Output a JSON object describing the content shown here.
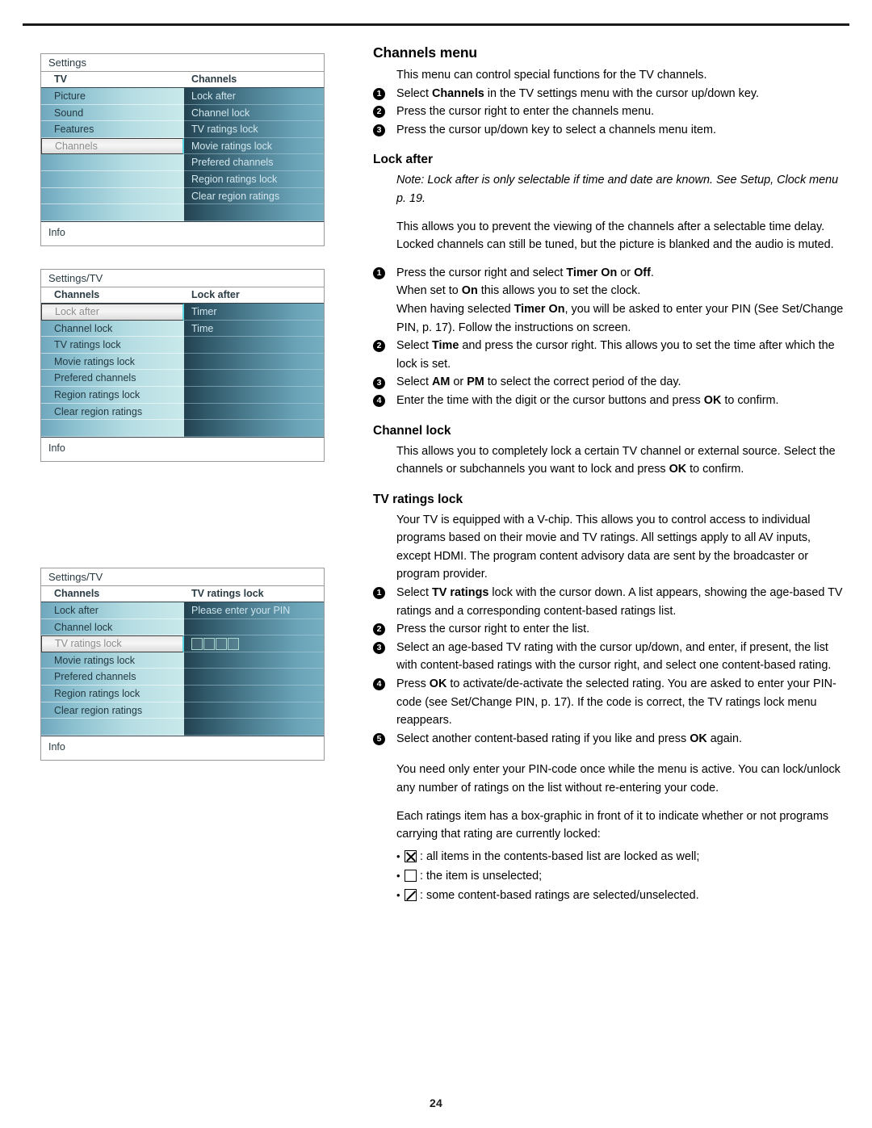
{
  "page": {
    "number": "24"
  },
  "osd_panels": [
    {
      "id": "settings-channels",
      "title": "Settings",
      "left_header": "TV",
      "right_header": "Channels",
      "left_items": [
        "Picture",
        "Sound",
        "Features",
        "Channels",
        "",
        "",
        "",
        ""
      ],
      "left_selected_index": 3,
      "right_items": [
        "Lock after",
        "Channel lock",
        "TV ratings lock",
        "Movie ratings lock",
        "Prefered channels",
        "Region ratings lock",
        "Clear region ratings",
        ""
      ],
      "info_label": "Info",
      "pin_prompt": "",
      "pin_boxes": 0
    },
    {
      "id": "settings-tv-lock-after",
      "title": "Settings/TV",
      "left_header": "Channels",
      "right_header": "Lock after",
      "left_items": [
        "Lock after",
        "Channel lock",
        "TV ratings lock",
        "Movie ratings lock",
        "Prefered channels",
        "Region ratings lock",
        "Clear region ratings",
        ""
      ],
      "left_selected_index": 0,
      "right_items": [
        "Timer",
        "Time",
        "",
        "",
        "",
        "",
        "",
        ""
      ],
      "info_label": "Info",
      "pin_prompt": "",
      "pin_boxes": 0
    },
    {
      "id": "settings-tv-ratings-lock",
      "title": "Settings/TV",
      "left_header": "Channels",
      "right_header": "TV ratings lock",
      "left_items": [
        "Lock after",
        "Channel lock",
        "TV ratings lock",
        "Movie ratings lock",
        "Prefered channels",
        "Region ratings lock",
        "Clear region ratings",
        ""
      ],
      "left_selected_index": 2,
      "right_items": [
        "Please enter your PIN",
        "",
        "",
        "",
        "",
        "",
        "",
        ""
      ],
      "info_label": "Info",
      "pin_prompt": "Please enter your PIN",
      "pin_boxes": 4
    }
  ],
  "doc": {
    "heading": "Channels menu",
    "intro": "This menu can control special functions for the TV channels.",
    "intro_steps": [
      {
        "num": "1",
        "html": "Select <b>Channels</b> in the TV settings menu with the cursor up/down key."
      },
      {
        "num": "2",
        "html": "Press the cursor right to enter the channels menu."
      },
      {
        "num": "3",
        "html": "Press the cursor up/down key to select a channels menu item."
      }
    ],
    "lock_after": {
      "heading": "Lock after",
      "note": "Note: Lock after is only selectable if time and date are known. See Setup, Clock menu p. 19.",
      "body": "This allows you to prevent the viewing of the channels after a selectable time delay. Locked channels can still be tuned, but the picture is blanked and the audio is muted.",
      "steps": [
        {
          "num": "1",
          "html": "Press the cursor right and select <b>Timer On</b> or <b>Off</b>.<br>When set to <b>On</b> this allows you to set the clock.<br>When having selected <b>Timer On</b>, you will be asked to enter your PIN (See Set/Change PIN, p. 17). Follow the instructions on screen."
        },
        {
          "num": "2",
          "html": "Select <b>Time</b> and press the cursor right. This allows you to set the time after which the lock is set."
        },
        {
          "num": "3",
          "html": "Select <b>AM</b> or <b>PM</b> to select the correct period of the day."
        },
        {
          "num": "4",
          "html": "Enter the time with the digit or the cursor buttons and press <b>OK</b> to confirm."
        }
      ]
    },
    "channel_lock": {
      "heading": "Channel lock",
      "body_html": "This allows you to completely lock a certain TV channel or external source. Select the channels or subchannels you want to lock and press <b>OK</b> to confirm."
    },
    "tv_ratings_lock": {
      "heading": "TV ratings lock",
      "body": "Your TV is equipped with a V-chip. This allows you to control access to individual programs based on their movie and TV ratings. All settings apply to all AV inputs, except HDMI. The program content advisory data are sent by the broadcaster or program provider.",
      "steps": [
        {
          "num": "1",
          "html": "Select <b>TV ratings</b> lock with the cursor down. A list appears, showing the age-based TV ratings and a corresponding content-based ratings list."
        },
        {
          "num": "2",
          "html": "Press the cursor right to enter the list."
        },
        {
          "num": "3",
          "html": "Select an age-based TV rating with the cursor up/down, and enter, if present, the list with content-based ratings with the cursor right, and select one content-based rating."
        },
        {
          "num": "4",
          "html": "Press <b>OK</b> to activate/de-activate the selected rating. You are asked to enter your PIN-code (see Set/Change PIN, p. 17). If the code is correct, the TV ratings lock menu reappears."
        },
        {
          "num": "5",
          "html": "Select another content-based rating if you like and press <b>OK</b> again."
        }
      ],
      "closing1": "You need only enter your PIN-code once while the menu is active. You can lock/unlock any number of ratings on the list without re-entering your code.",
      "closing2": "Each ratings item has a box-graphic in front of it to indicate whether or not programs carrying that rating are currently locked:",
      "box_legend": [
        {
          "glyph": "x",
          "text": ": all items in the contents-based list are locked as well;"
        },
        {
          "glyph": "empty",
          "text": ": the item is unselected;"
        },
        {
          "glyph": "slash",
          "text": ": some content-based ratings are selected/unselected."
        }
      ]
    }
  }
}
